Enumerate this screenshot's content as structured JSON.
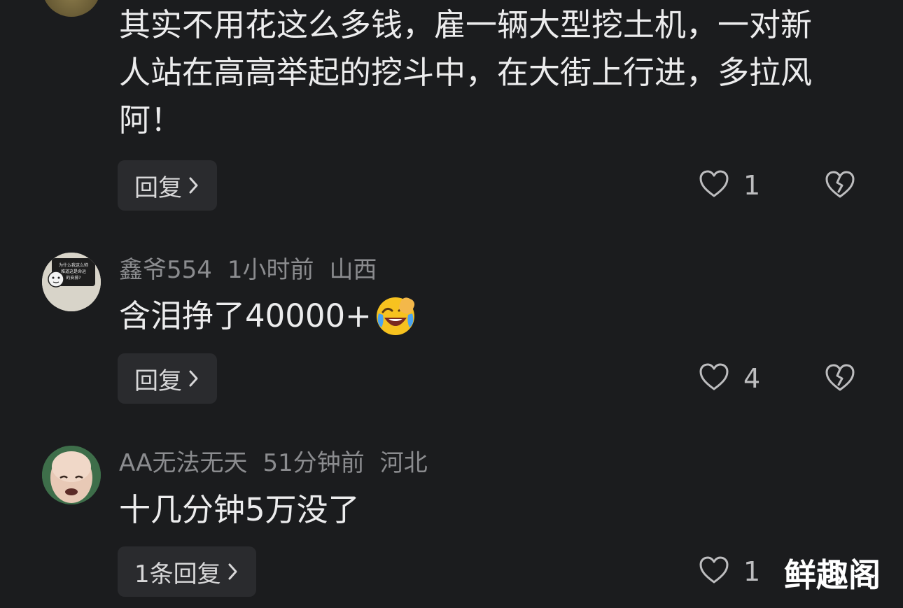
{
  "comments": [
    {
      "username": "",
      "time": "",
      "location": "",
      "text": "其实不用花这么多钱，雇一辆大型挖土机，一对新\n人站在高高举起的挖斗中，在大街上行进，多拉风\n阿！",
      "reply_label": "回复",
      "likes": "1"
    },
    {
      "username": "鑫爷554",
      "time": "1小时前",
      "location": "山西",
      "text": "含泪挣了40000+",
      "emoji": "laughing-crying-emoji",
      "avatar_caption": "为什么我这么帅 难道这是命运 的安排?",
      "reply_label": "回复",
      "likes": "4"
    },
    {
      "username": "AA无法无天",
      "time": "51分钟前",
      "location": "河北",
      "text": "十几分钟5万没了",
      "reply_label": "1条回复",
      "likes": "1"
    }
  ],
  "watermark": "鲜趣阁",
  "colors": {
    "background": "#1b1c1e",
    "meta_text": "#8b8c8f",
    "body_text": "#ececed",
    "button_bg": "#2a2b2e"
  }
}
